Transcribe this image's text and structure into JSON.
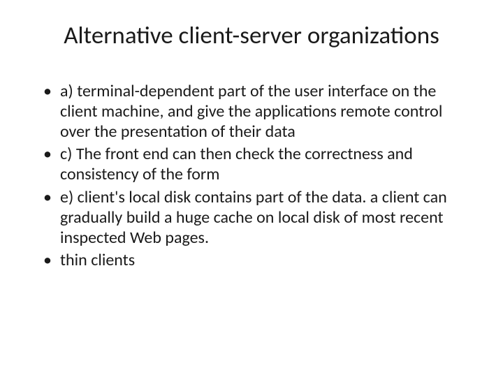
{
  "slide": {
    "title": "Alternative client-server organizations",
    "bullets": [
      "a) terminal-dependent part of the user interface on the client machine, and give the applications remote control over the presentation of their data",
      "c) The front end can then check the correctness and consistency of the form",
      "e) client's local disk contains part of the data. a client can gradually build a huge cache on local disk of most recent inspected Web pages.",
      "thin clients"
    ]
  }
}
